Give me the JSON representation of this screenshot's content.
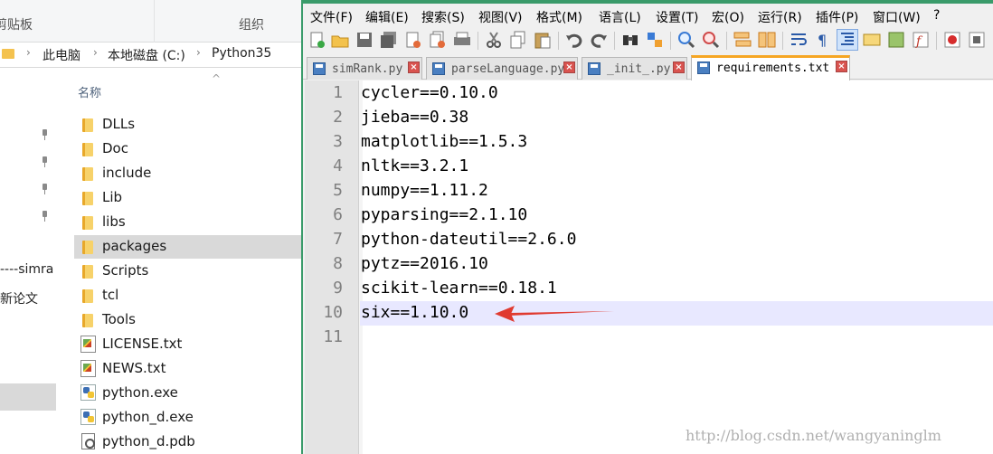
{
  "explorer": {
    "ribbon": {
      "clipboard_label": "剪贴板",
      "organize_label": "组织"
    },
    "breadcrumb": [
      "此电脑",
      "本地磁盘 (C:)",
      "Python35"
    ],
    "nav_items": [
      {
        "text": "----simra"
      },
      {
        "text": "新论文"
      }
    ],
    "column_header": "名称",
    "files": [
      {
        "name": "DLLs",
        "type": "folder"
      },
      {
        "name": "Doc",
        "type": "folder"
      },
      {
        "name": "include",
        "type": "folder"
      },
      {
        "name": "Lib",
        "type": "folder"
      },
      {
        "name": "libs",
        "type": "folder"
      },
      {
        "name": "packages",
        "type": "folder",
        "selected": true
      },
      {
        "name": "Scripts",
        "type": "folder"
      },
      {
        "name": "tcl",
        "type": "folder"
      },
      {
        "name": "Tools",
        "type": "folder"
      },
      {
        "name": "LICENSE.txt",
        "type": "txt"
      },
      {
        "name": "NEWS.txt",
        "type": "txt"
      },
      {
        "name": "python.exe",
        "type": "exe"
      },
      {
        "name": "python_d.exe",
        "type": "exe"
      },
      {
        "name": "python_d.pdb",
        "type": "pdb"
      }
    ]
  },
  "npp": {
    "menu": [
      "文件(F)",
      "编辑(E)",
      "搜索(S)",
      "视图(V)",
      "格式(M)",
      "语言(L)",
      "设置(T)",
      "宏(O)",
      "运行(R)",
      "插件(P)",
      "窗口(W)",
      "?"
    ],
    "tabs": [
      {
        "label": "simRank.py",
        "active": false
      },
      {
        "label": "parseLanguage.py",
        "active": false
      },
      {
        "label": "_init_.py",
        "active": false
      },
      {
        "label": "requirements.txt",
        "active": true
      }
    ],
    "tab_close_glyph": "×",
    "editor": {
      "lines": [
        "cycler==0.10.0",
        "jieba==0.38",
        "matplotlib==1.5.3",
        "nltk==3.2.1",
        "numpy==1.11.2",
        "pyparsing==2.1.10",
        "python-dateutil==2.6.0",
        "pytz==2016.10",
        "scikit-learn==0.18.1",
        "six==1.10.0",
        ""
      ],
      "current_line": 10
    },
    "watermark": "http://blog.csdn.net/wangyaninglm"
  },
  "colors": {
    "accent_green": "#3a9b6a",
    "active_tab_accent": "#f6a623",
    "annotation_arrow": "#e03a30",
    "current_line_bg": "#e8e8ff"
  }
}
